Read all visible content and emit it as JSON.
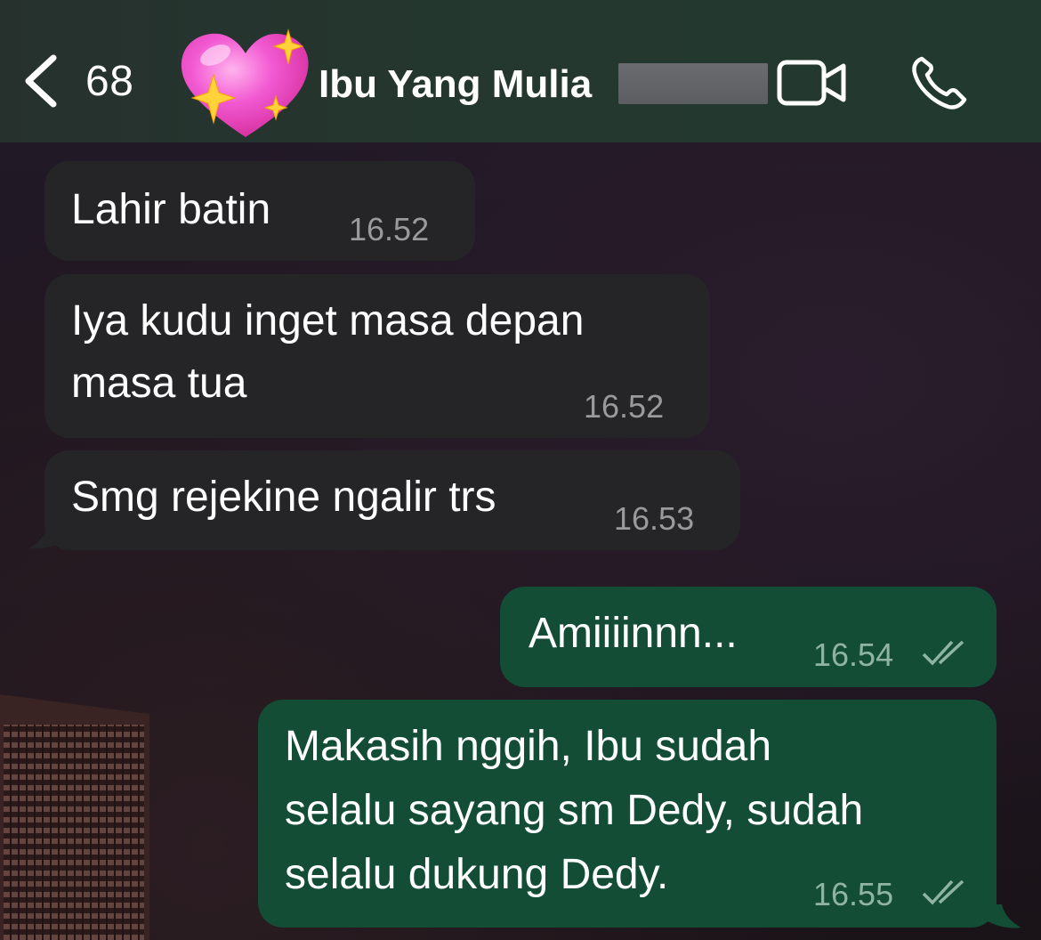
{
  "header": {
    "back_count": "68",
    "contact_name": "Ibu Yang Mulia",
    "avatar_icon": "sparkling-heart-icon",
    "video_icon": "video-camera-icon",
    "phone_icon": "phone-icon"
  },
  "messages": [
    {
      "direction": "incoming",
      "text": "Lahir batin",
      "time": "16.52"
    },
    {
      "direction": "incoming",
      "lines": [
        "Iya kudu inget masa depan",
        "masa tua"
      ],
      "time": "16.52"
    },
    {
      "direction": "incoming",
      "text": "Smg rejekine ngalir trs",
      "time": "16.53"
    },
    {
      "direction": "outgoing",
      "text": "Amiiiinnn...",
      "time": "16.54",
      "status": "read"
    },
    {
      "direction": "outgoing",
      "lines": [
        "Makasih nggih, Ibu sudah",
        "selalu sayang sm Dedy, sudah",
        "selalu dukung Dedy."
      ],
      "time": "16.55",
      "status": "read"
    }
  ],
  "colors": {
    "header_bg": "#24382f",
    "incoming_bubble": "#252527",
    "outgoing_bubble": "#134d36",
    "timestamp": "#9a9a9c"
  }
}
